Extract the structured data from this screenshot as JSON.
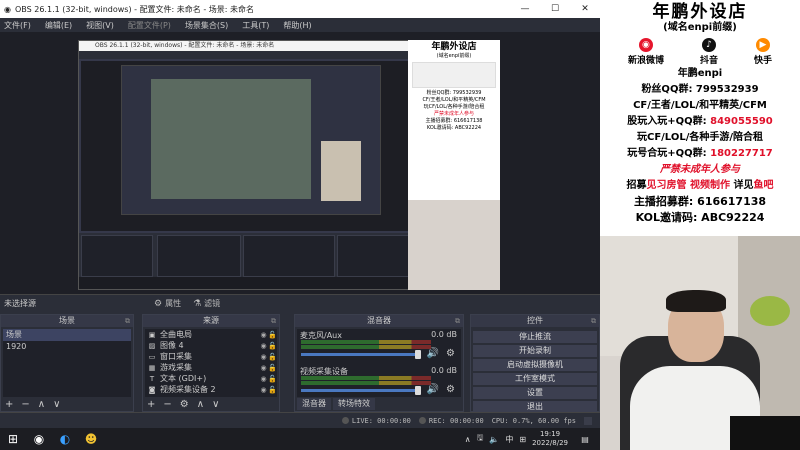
{
  "window": {
    "title": "OBS 26.1.1 (32-bit, windows) - 配置文件: 未命名 - 场景: 未命名",
    "controls": [
      "—",
      "☐",
      "✕"
    ]
  },
  "menu": [
    "文件(F)",
    "编辑(E)",
    "视图(V)",
    "配置文件(P)",
    "场景集合(S)",
    "工具(T)",
    "帮助(H)"
  ],
  "nested": {
    "title": "OBS 26.1.1 (32-bit, windows) - 配置文件: 未命名 - 场景: 未命名"
  },
  "source_bar": {
    "label": "未选择源",
    "properties": "属性",
    "filters": "滤镜"
  },
  "scenes": {
    "header": "场景",
    "items": [
      "场景",
      "1920"
    ],
    "footer": [
      "+",
      "−",
      "∧",
      "∨"
    ]
  },
  "sources": {
    "header": "来源",
    "items": [
      {
        "icon": "▣",
        "name": "全曲电局"
      },
      {
        "icon": "▨",
        "name": "图像 4"
      },
      {
        "icon": "▭",
        "name": "窗口采集"
      },
      {
        "icon": "▦",
        "name": "游戏采集"
      },
      {
        "icon": "T",
        "name": "文本 (GDI+)"
      },
      {
        "icon": "◙",
        "name": "视频采集设备 2"
      }
    ],
    "footer": [
      "+",
      "−",
      "⚙",
      "∧",
      "∨"
    ]
  },
  "mixer": {
    "header": "混音器",
    "channels": [
      {
        "name": "麦克风/Aux",
        "db": "0.0 dB"
      },
      {
        "name": "视频采集设备",
        "db": "0.0 dB"
      }
    ],
    "tabs": [
      "混音器",
      "转场特效"
    ]
  },
  "controls": {
    "header": "控件",
    "buttons": [
      "停止推流",
      "开始录制",
      "启动虚拟摄像机",
      "工作室模式",
      "设置",
      "退出"
    ]
  },
  "status": {
    "live": "LIVE: 00:00:00",
    "rec": "REC: 00:00:00",
    "cpu": "CPU: 0.7%, 60.00 fps"
  },
  "taskbar": {
    "tray": [
      "∧",
      "🖫",
      "🔈",
      "中",
      "⊞"
    ],
    "time": "19:19",
    "date": "2022/8/29"
  },
  "ad": {
    "title": "年鹏外设店",
    "subtitle": "(域名enpi前缀)",
    "platforms": [
      {
        "label": "新浪微博",
        "icon": "weibo-icon",
        "color": "#e6162d"
      },
      {
        "label": "抖音",
        "icon": "douyin-icon",
        "color": "#111111"
      },
      {
        "label": "快手",
        "icon": "kuaishou-icon",
        "color": "#ff8a00"
      }
    ],
    "platform_name": "年鹏enpi",
    "fans_qq": "粉丝QQ群: 799532939",
    "games": "CF/王者/LOL/和平精英/CFM",
    "join_group_label": "股玩入玩+QQ群: ",
    "join_group_num": "849055590",
    "play_rent": "玩CF/LOL/各种手游/陪合租",
    "play_group_label": "玩号合玩+QQ群: ",
    "play_group_num": "180227717",
    "minors": "严禁未成年人参与",
    "recruit_a": "招募",
    "recruit_b": "见习房管",
    "recruit_c": "视频制作",
    "recruit_d": "详见",
    "recruit_e": "鱼吧",
    "host_recruit": "主播招募群: 616617138",
    "kol_code": "KOL邀请码: ABC92224"
  }
}
